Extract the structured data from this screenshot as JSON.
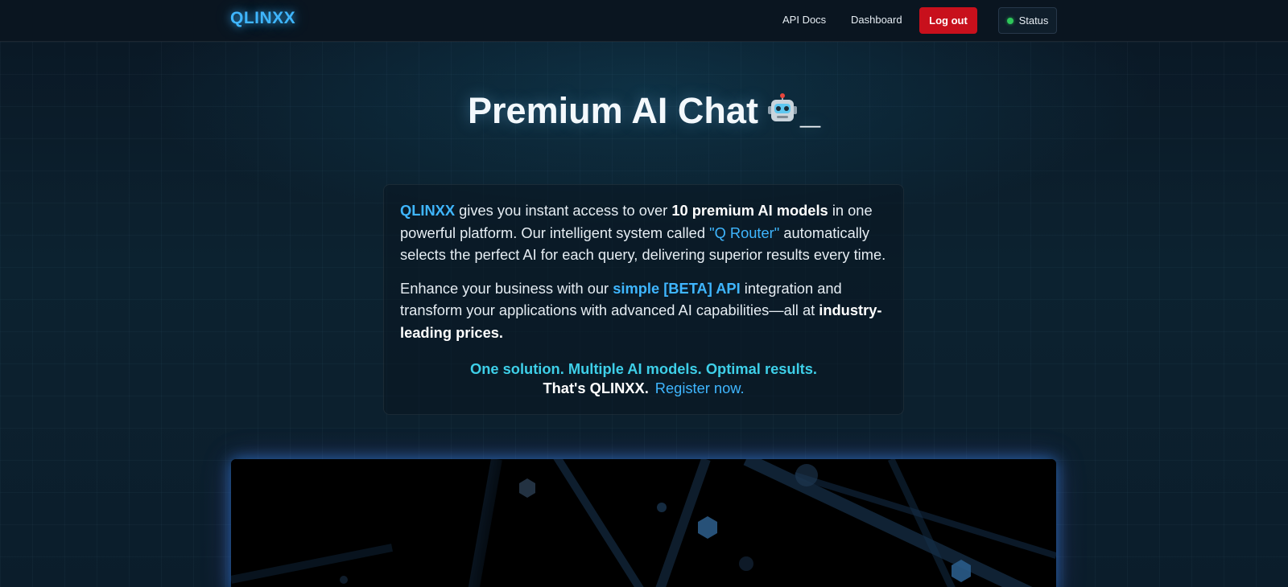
{
  "header": {
    "logo": "QLINXX",
    "nav": {
      "api_docs": "API Docs",
      "dashboard": "Dashboard"
    },
    "logout_label": "Log out",
    "status_label": "Status",
    "status_color": "#2ec65a"
  },
  "hero": {
    "title": "Premium AI Chat",
    "emoji": "robot-icon",
    "cursor": "_"
  },
  "intro": {
    "p1": {
      "brand": "QLINXX",
      "t1": " gives you instant access to over ",
      "bold1": "10 premium AI models",
      "t2": " in one powerful platform. Our intelligent system called ",
      "router": "\"Q Router\"",
      "t3": " automatically selects the perfect AI for each query, delivering superior results every time."
    },
    "p2": {
      "t1": "Enhance your business with our ",
      "api": "simple [BETA] API",
      "t2": " integration and transform your applications with advanced AI capabilities—all at ",
      "bold": "industry-leading prices."
    },
    "tagline": "One solution. Multiple AI models. Optimal results.",
    "tagline2": "That's QLINXX.",
    "register": "Register now."
  },
  "colors": {
    "accent": "#3fb6ff",
    "tagline": "#3ecfe8",
    "logout": "#c8101c",
    "background": "#0b1a26"
  }
}
